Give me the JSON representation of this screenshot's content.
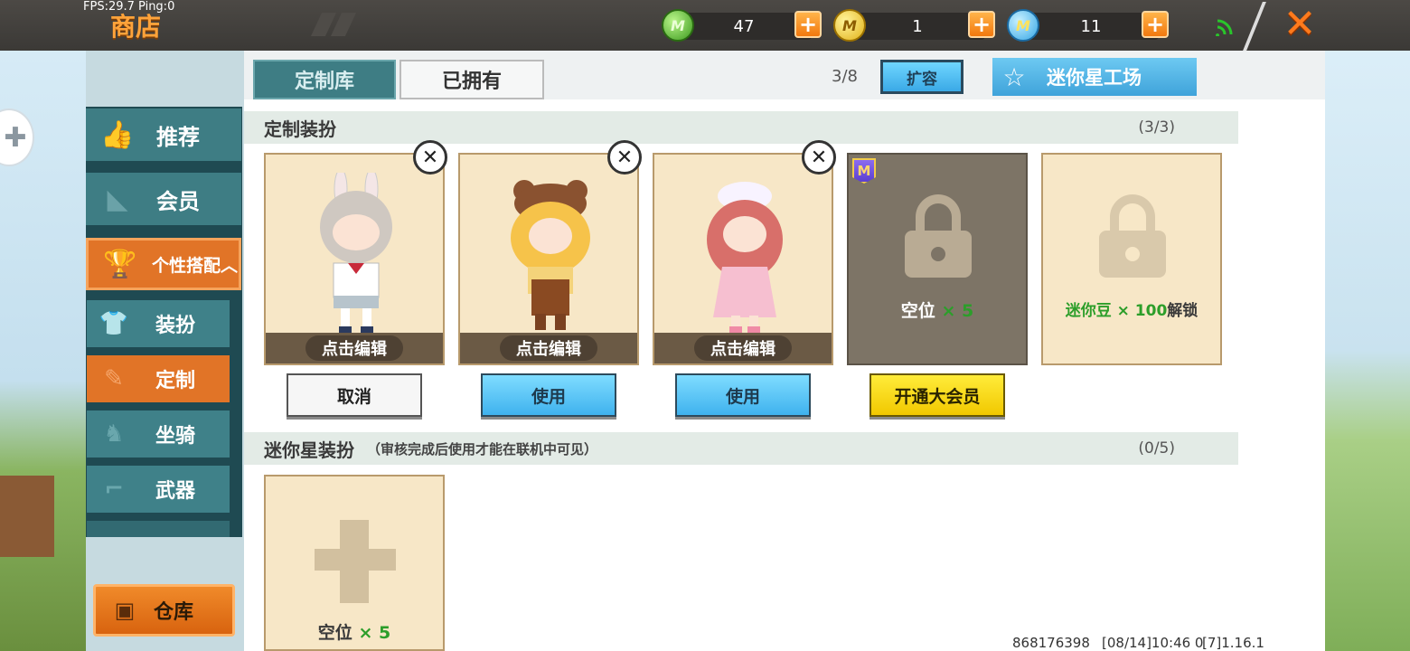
{
  "hud": {
    "fps": "FPS:29.7  Ping:0"
  },
  "header": {
    "title": "商店"
  },
  "currencies": [
    {
      "name": "green-coin",
      "icon": "mini-coin-green-icon",
      "amount": "47",
      "glyph": "M"
    },
    {
      "name": "gold-coin",
      "icon": "mini-coin-gold-icon",
      "amount": "1",
      "glyph": "M"
    },
    {
      "name": "mini-bean",
      "icon": "mini-bean-blue-icon",
      "amount": "11",
      "glyph": "M"
    }
  ],
  "sidebar": {
    "items": [
      {
        "label": "推荐",
        "icon": "thumbs-up-icon"
      },
      {
        "label": "会员",
        "icon": "vip-icon"
      },
      {
        "label": "个性搭配",
        "icon": "trophy-icon",
        "expanded": true,
        "arrow": "︿"
      }
    ],
    "subitems": [
      {
        "label": "装扮",
        "icon": "shirt-icon"
      },
      {
        "label": "定制",
        "icon": "pencil-icon",
        "active": true
      },
      {
        "label": "坐骑",
        "icon": "mount-icon"
      },
      {
        "label": "武器",
        "icon": "gun-icon"
      }
    ],
    "warehouse": "仓库"
  },
  "tabs": [
    {
      "label": "定制库",
      "active": true
    },
    {
      "label": "已拥有",
      "active": false
    }
  ],
  "toolbar": {
    "capacity": "3/8",
    "expand_label": "扩容",
    "factory_label": "迷你星工场"
  },
  "custom_section": {
    "title": "定制装扮",
    "count": "(3/3)",
    "cards": [
      {
        "edit_label": "点击编辑",
        "action": "取消",
        "action_type": "cancel"
      },
      {
        "edit_label": "点击编辑",
        "action": "使用",
        "action_type": "use"
      },
      {
        "edit_label": "点击编辑",
        "action": "使用",
        "action_type": "use"
      }
    ],
    "locked_vip": {
      "slot_label": "空位",
      "slot_count": "× 5",
      "action": "开通大会员",
      "badge": "M"
    },
    "locked_bean": {
      "unlock_prefix": "迷你豆 × 100",
      "unlock_suffix": "解锁"
    }
  },
  "star_section": {
    "title": "迷你星装扮",
    "note": "（审核完成后使用才能在联机中可见）",
    "count": "(0/5)",
    "add_slot": {
      "slot_label": "空位",
      "slot_count": "× 5"
    }
  },
  "footer": {
    "uid": "868176398",
    "time": "[08/14]10:46 0",
    "version": "[7]1.16.1"
  },
  "colors": {
    "accent_orange": "#e17427",
    "teal": "#3e7d84",
    "use_blue": "#3fb2ee",
    "vip_yellow": "#f1c800",
    "slot_green": "#2c9e2a"
  }
}
